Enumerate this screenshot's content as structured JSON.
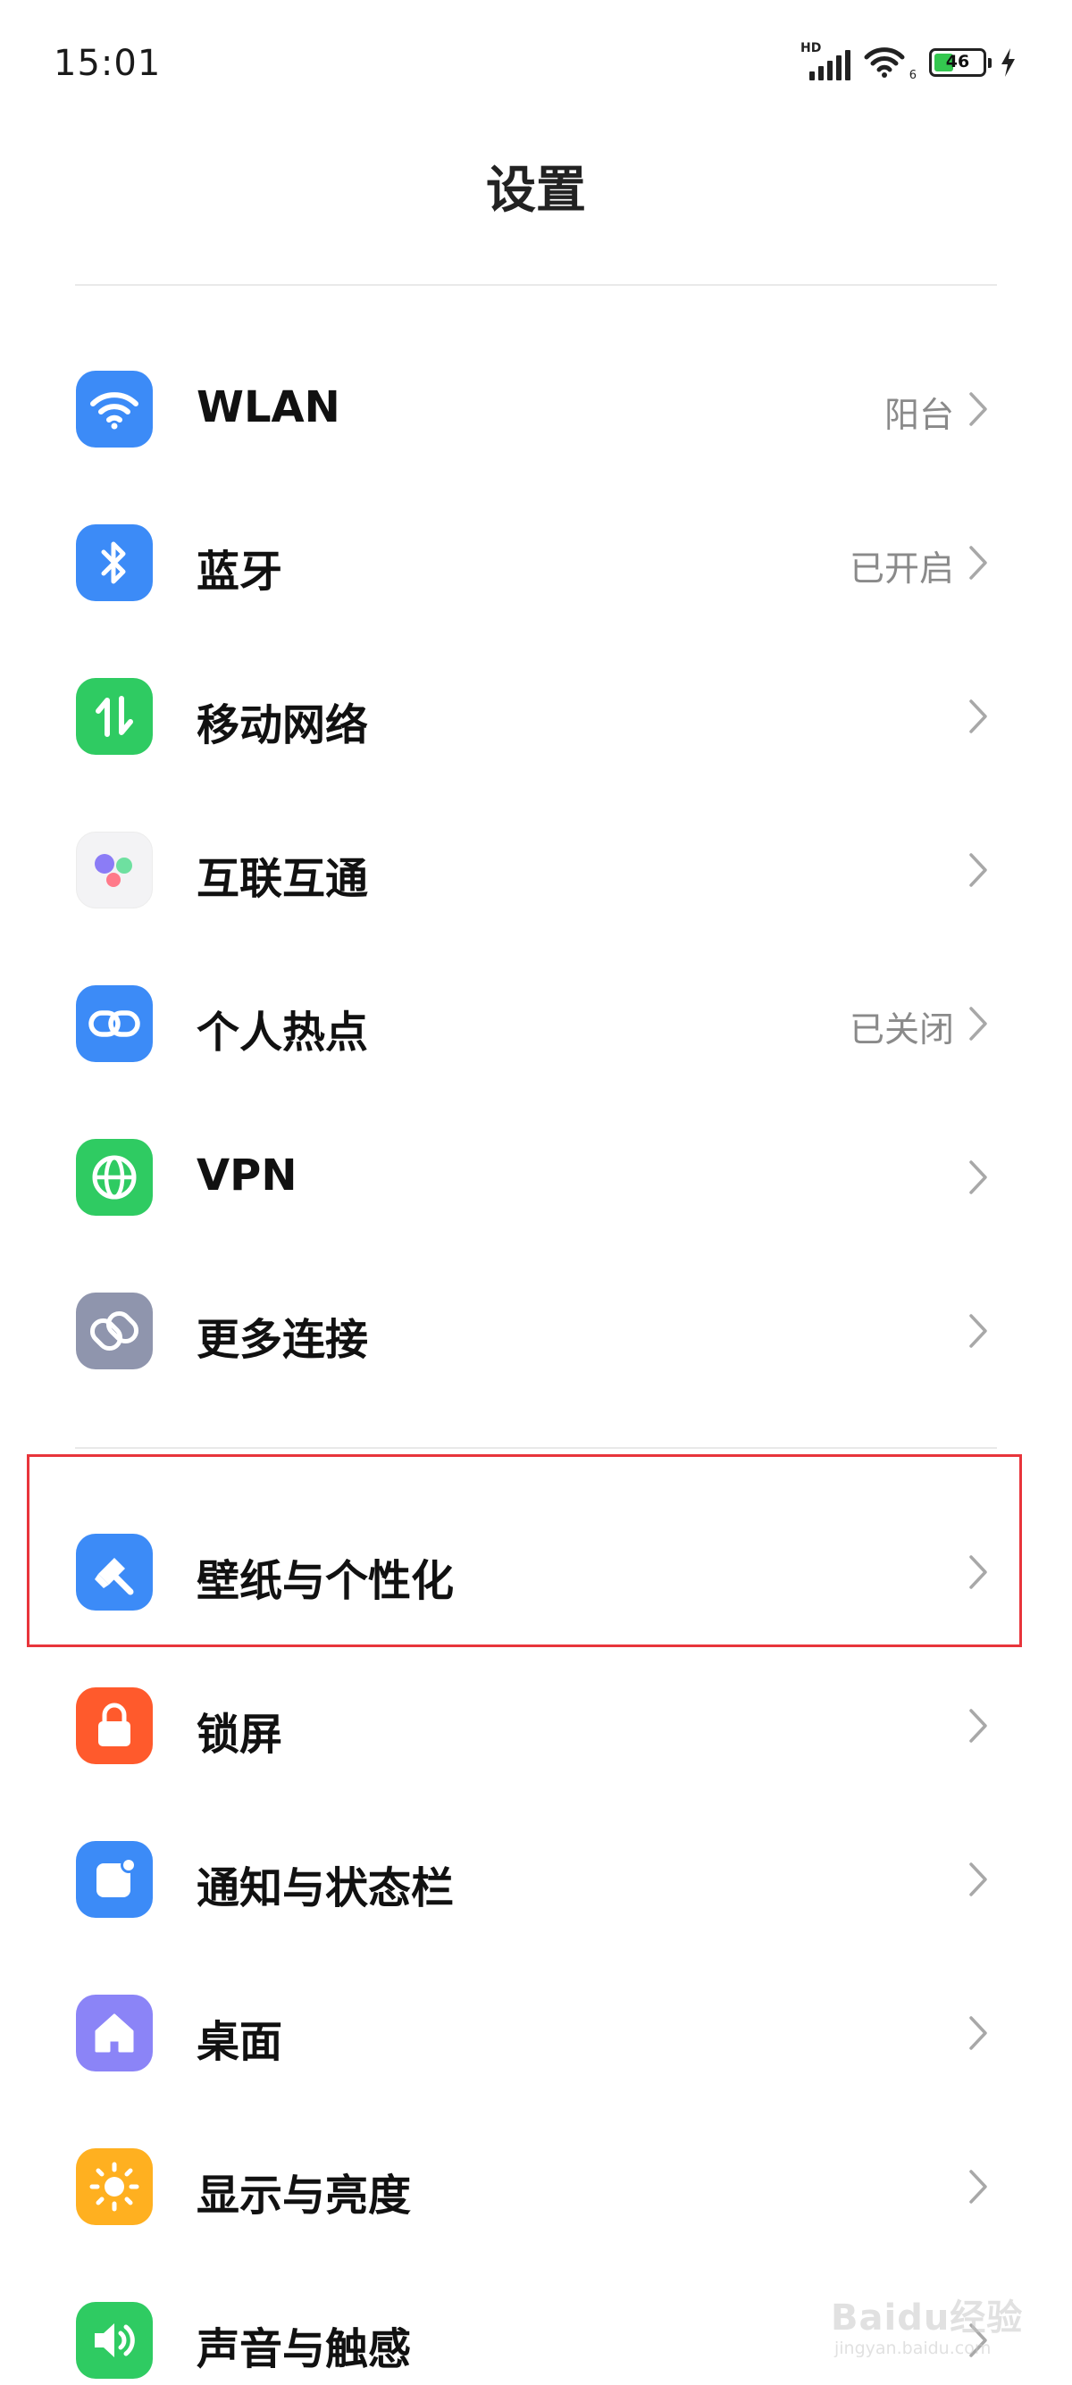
{
  "status_bar": {
    "time": "15:01",
    "network_label": "HD",
    "wifi_badge": "6",
    "battery_level": "46"
  },
  "header": {
    "title": "设置"
  },
  "groups": [
    {
      "items": [
        {
          "label": "WLAN",
          "value": "阳台",
          "icon": "wifi-icon",
          "color": "#3c8bf7"
        },
        {
          "label": "蓝牙",
          "value": "已开启",
          "icon": "bluetooth-icon",
          "color": "#3c8bf7"
        },
        {
          "label": "移动网络",
          "value": "",
          "icon": "mobile-data-icon",
          "color": "#2fcb62"
        },
        {
          "label": "互联互通",
          "value": "",
          "icon": "interconnect-icon",
          "color": "#f3f3f5"
        },
        {
          "label": "个人热点",
          "value": "已关闭",
          "icon": "hotspot-link-icon",
          "color": "#3c8bf7"
        },
        {
          "label": "VPN",
          "value": "",
          "icon": "globe-icon",
          "color": "#2fcb62"
        },
        {
          "label": "更多连接",
          "value": "",
          "icon": "more-connections-icon",
          "color": "#8f95ad"
        }
      ]
    },
    {
      "items": [
        {
          "label": "壁纸与个性化",
          "value": "",
          "icon": "brush-icon",
          "color": "#3c8bf7"
        },
        {
          "label": "锁屏",
          "value": "",
          "icon": "lock-icon",
          "color": "#ff5a2c"
        },
        {
          "label": "通知与状态栏",
          "value": "",
          "icon": "notification-icon",
          "color": "#3c8bf7"
        },
        {
          "label": "桌面",
          "value": "",
          "icon": "home-icon",
          "color": "#8b84f7"
        },
        {
          "label": "显示与亮度",
          "value": "",
          "icon": "sun-icon",
          "color": "#ffb020"
        },
        {
          "label": "声音与触感",
          "value": "",
          "icon": "speaker-icon",
          "color": "#2fcb62"
        }
      ]
    }
  ],
  "highlight_color": "#e8353b",
  "watermark": {
    "text": "Baidu经验",
    "url": "jingyan.baidu.com"
  }
}
